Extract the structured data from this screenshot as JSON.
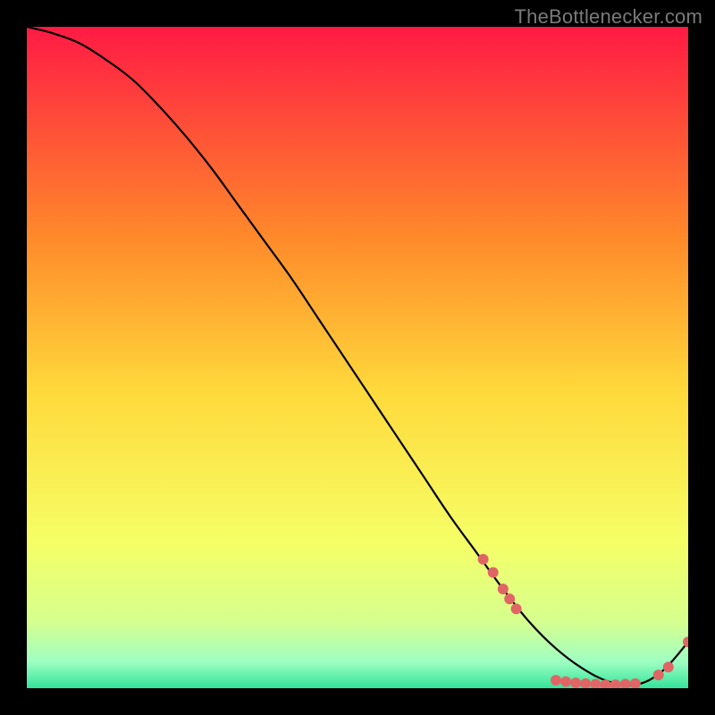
{
  "watermark": "TheBottlenecker.com",
  "colors": {
    "curve": "#000000",
    "marker": "#e06666",
    "frame_bg": "#000000",
    "gradient_top": "#ff1a44",
    "gradient_mid_upper": "#ff8a2a",
    "gradient_mid": "#ffd93b",
    "gradient_mid_lower": "#f5ff66",
    "gradient_low1": "#d6ff8f",
    "gradient_low2": "#9effc2",
    "gradient_bottom": "#34e39a"
  },
  "chart_data": {
    "type": "line",
    "title": "",
    "xlabel": "",
    "ylabel": "",
    "xlim": [
      0,
      100
    ],
    "ylim": [
      0,
      100
    ],
    "grid": false,
    "legend": false,
    "curve": {
      "x": [
        0,
        4,
        8,
        12,
        16,
        20,
        24,
        28,
        32,
        36,
        40,
        44,
        48,
        52,
        56,
        60,
        64,
        68,
        72,
        76,
        80,
        84,
        88,
        92,
        96,
        100
      ],
      "y": [
        100,
        99,
        97.5,
        95,
        92,
        88,
        83.5,
        78.5,
        73,
        67.5,
        62,
        56,
        50,
        44,
        38,
        32,
        26,
        20.5,
        15,
        10,
        6,
        3,
        1,
        0.5,
        2.5,
        7
      ]
    },
    "markers": [
      {
        "x": 69.0,
        "y": 19.5
      },
      {
        "x": 70.5,
        "y": 17.5
      },
      {
        "x": 72.0,
        "y": 15.0
      },
      {
        "x": 73.0,
        "y": 13.5
      },
      {
        "x": 74.0,
        "y": 12.0
      },
      {
        "x": 80.0,
        "y": 1.2
      },
      {
        "x": 81.5,
        "y": 1.0
      },
      {
        "x": 83.0,
        "y": 0.8
      },
      {
        "x": 84.5,
        "y": 0.7
      },
      {
        "x": 86.0,
        "y": 0.6
      },
      {
        "x": 87.5,
        "y": 0.5
      },
      {
        "x": 89.0,
        "y": 0.5
      },
      {
        "x": 90.5,
        "y": 0.6
      },
      {
        "x": 92.0,
        "y": 0.7
      },
      {
        "x": 95.5,
        "y": 2.0
      },
      {
        "x": 97.0,
        "y": 3.2
      },
      {
        "x": 100.0,
        "y": 7.0
      }
    ]
  }
}
